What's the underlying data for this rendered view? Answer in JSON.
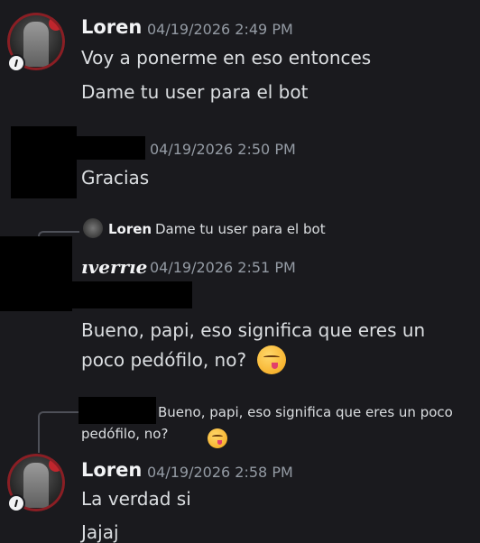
{
  "messages": [
    {
      "author": "Loren",
      "timestamp": "04/19/2026 2:49 PM",
      "lines": [
        "Voy a ponerme en eso entonces",
        "Dame tu user para el bot"
      ]
    },
    {
      "author": "",
      "timestamp": "04/19/2026 2:50 PM",
      "lines": [
        "Gracias"
      ]
    },
    {
      "reply": {
        "author": "Loren",
        "text": "Dame tu user para el bot"
      },
      "author": "ıverrıe",
      "timestamp": "04/19/2026 2:51 PM",
      "lines": [
        "Bueno, papi, eso  significa que eres un",
        "poco pedófilo, no?"
      ]
    },
    {
      "reply": {
        "text_line1": "Bueno, papi, eso  significa que eres un poco",
        "text_line2": "pedófilo, no?"
      },
      "author": "Loren",
      "timestamp": "04/19/2026 2:58 PM",
      "lines": [
        "La verdad si",
        "Jajaj"
      ]
    }
  ],
  "emoji": "yum-face-emoji"
}
